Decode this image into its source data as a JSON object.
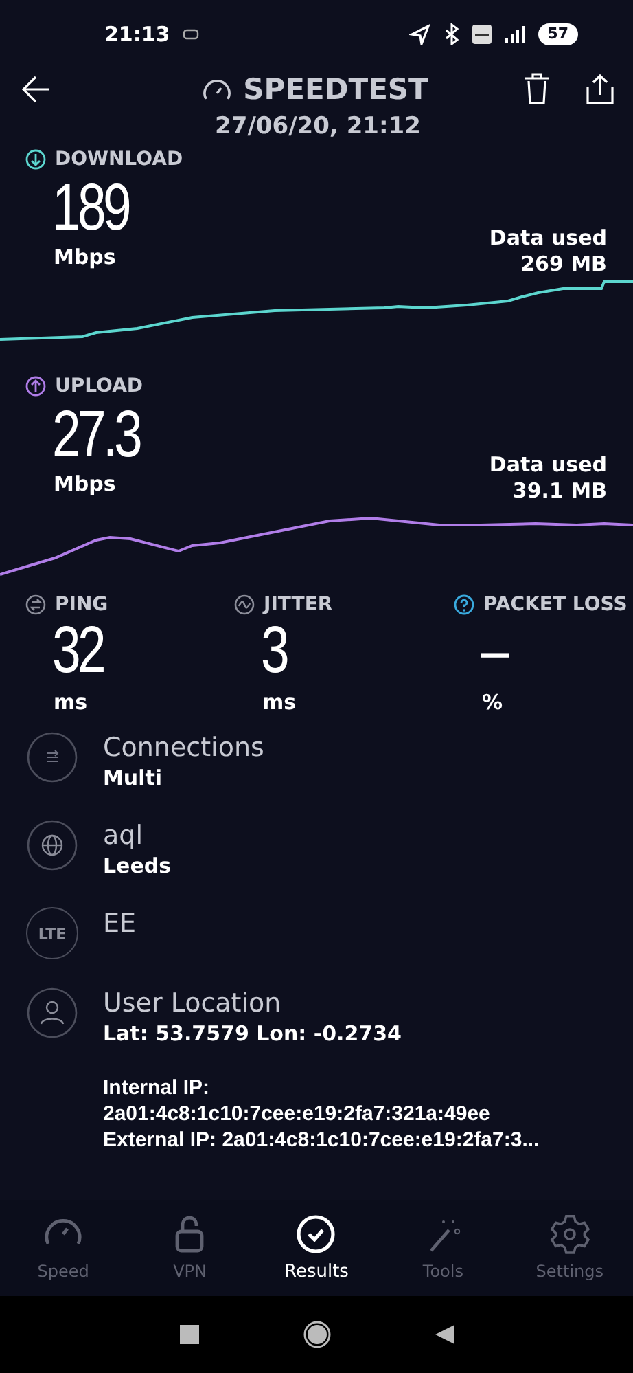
{
  "status_bar": {
    "time": "21:13",
    "battery": "57"
  },
  "header": {
    "title": "SPEEDTEST",
    "date": "27/06/20, 21:12"
  },
  "results": [
    {
      "kind": "download",
      "label": "DOWNLOAD",
      "value": "189",
      "unit": "Mbps",
      "data_used_label": "Data used",
      "data_used": "269 MB"
    },
    {
      "kind": "upload",
      "label": "UPLOAD",
      "value": "27.3",
      "unit": "Mbps",
      "data_used_label": "Data used",
      "data_used": "39.1 MB"
    }
  ],
  "metrics": [
    {
      "kind": "ping",
      "label": "PING",
      "value": "32",
      "unit": "ms"
    },
    {
      "kind": "jitter",
      "label": "JITTER",
      "value": "3",
      "unit": "ms"
    },
    {
      "kind": "packet_loss",
      "label": "PACKET LOSS",
      "value": "–",
      "unit": "%"
    }
  ],
  "info": [
    {
      "kind": "connections",
      "title": "Connections",
      "detail": "Multi"
    },
    {
      "kind": "server",
      "title": "aql",
      "detail": "Leeds"
    },
    {
      "kind": "network",
      "badge": "LTE",
      "title": "EE"
    },
    {
      "kind": "location",
      "title": "User Location",
      "detail": "Lat: 53.7579 Lon: -0.2734",
      "extra": [
        "Internal IP:",
        "2a01:4c8:1c10:7cee:e19:2fa7:321a:49ee",
        "External IP: 2a01:4c8:1c10:7cee:e19:2fa7:3..."
      ]
    }
  ],
  "nav": [
    {
      "kind": "speed",
      "label": "Speed",
      "selected": false
    },
    {
      "kind": "vpn",
      "label": "VPN",
      "selected": false
    },
    {
      "kind": "results",
      "label": "Results",
      "selected": true
    },
    {
      "kind": "tools",
      "label": "Tools",
      "selected": false
    },
    {
      "kind": "settings",
      "label": "Settings",
      "selected": false
    }
  ]
}
